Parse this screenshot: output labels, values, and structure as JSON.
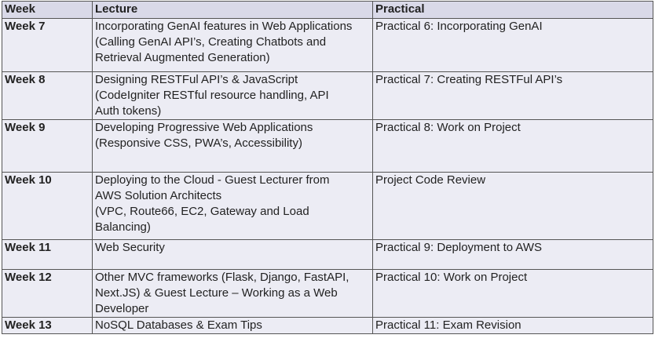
{
  "table": {
    "headers": [
      "Week",
      "Lecture",
      "Practical"
    ],
    "rows": [
      {
        "week": "Week 7",
        "lecture": [
          "Incorporating GenAI features in Web Applications",
          "(Calling GenAI API’s, Creating Chatbots and",
          "Retrieval Augmented Generation)"
        ],
        "practical": "Practical 6: Incorporating GenAI"
      },
      {
        "week": "Week 8",
        "lecture": [
          "Designing RESTFul API’s & JavaScript",
          "(CodeIgniter RESTful resource handling, API",
          "Auth tokens)"
        ],
        "practical": "Practical 7: Creating RESTFul API’s"
      },
      {
        "week": "Week 9",
        "lecture": [
          "Developing Progressive Web Applications",
          "(Responsive CSS, PWA’s, Accessibility)"
        ],
        "practical": "Practical 8: Work on Project"
      },
      {
        "week": "Week 10",
        "lecture": [
          "Deploying to the Cloud - Guest Lecturer from",
          "AWS Solution Architects",
          "(VPC, Route66, EC2, Gateway and Load",
          "Balancing)"
        ],
        "practical": "Project Code Review"
      },
      {
        "week": "Week 11",
        "lecture": [
          "Web Security"
        ],
        "practical": "Practical 9: Deployment to AWS"
      },
      {
        "week": "Week 12",
        "lecture": [
          "Other MVC frameworks (Flask, Django, FastAPI,",
          "Next.JS) & Guest Lecture – Working as a Web",
          "Developer"
        ],
        "practical": "Practical 10: Work on Project"
      },
      {
        "week": "Week 13",
        "lecture": [
          "NoSQL Databases & Exam Tips"
        ],
        "practical": "Practical 11: Exam Revision"
      }
    ]
  }
}
